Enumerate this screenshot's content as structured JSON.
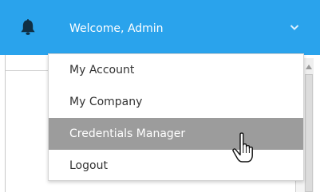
{
  "header": {
    "welcome_text": "Welcome,  Admin",
    "bell_icon": "bell-icon",
    "chevron_icon": "chevron-down-icon",
    "background_color": "#2aa3ec"
  },
  "menu": {
    "items": [
      {
        "label": "My Account"
      },
      {
        "label": "My Company"
      },
      {
        "label": "Credentials Manager",
        "highlighted": true
      },
      {
        "label": "Logout"
      }
    ],
    "highlight_color": "#9c9c9c"
  },
  "cursor": {
    "icon": "hand-pointer-cursor-icon"
  }
}
